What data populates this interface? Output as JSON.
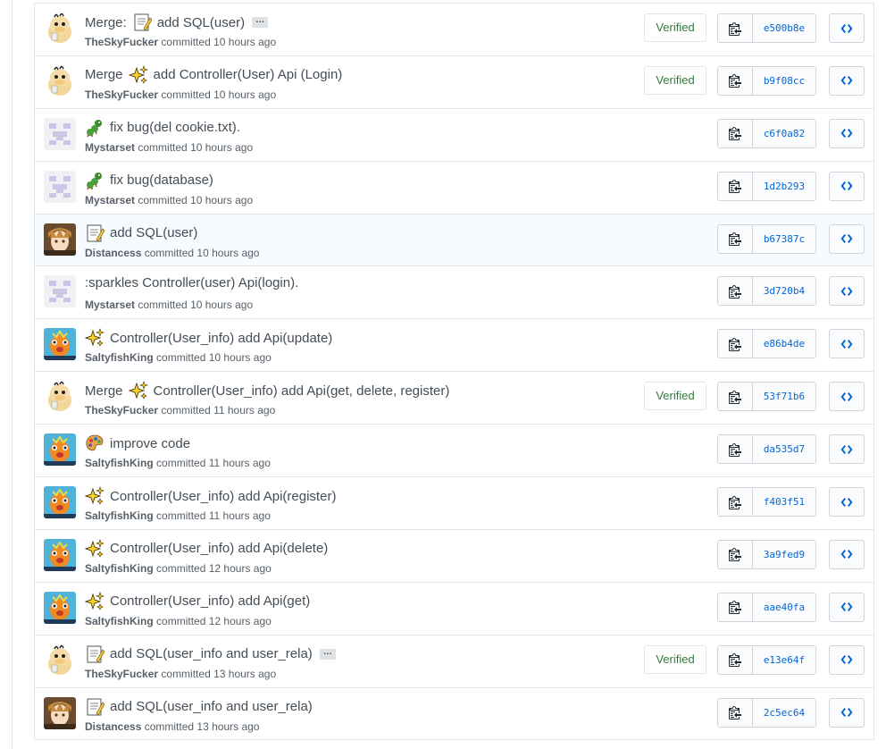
{
  "colors": {
    "link": "#0366d6",
    "verified": "#2f7a3c",
    "border": "#e1e4e8"
  },
  "commits": [
    {
      "merge": true,
      "merge_label": "Merge:",
      "emoji": "memo-emoji",
      "message": "add SQL(user)",
      "ellipsis": true,
      "ellipsis_label": "…",
      "author": "TheSkyFucker",
      "avatar": "duck-avatar",
      "committed": "committed",
      "time": "10 hours ago",
      "verified": true,
      "verified_label": "Verified",
      "sha": "e500b8e"
    },
    {
      "merge": true,
      "merge_label": "Merge",
      "emoji": "sparkles-emoji",
      "message": "add Controller(User) Api (Login)",
      "ellipsis": false,
      "author": "TheSkyFucker",
      "avatar": "duck-avatar",
      "committed": "committed",
      "time": "10 hours ago",
      "verified": true,
      "verified_label": "Verified",
      "sha": "b9f08cc"
    },
    {
      "merge": false,
      "emoji": "bug-emoji",
      "message": "fix bug(del cookie.txt).",
      "ellipsis": false,
      "author": "Mystarset",
      "avatar": "identicon-avatar",
      "committed": "committed",
      "time": "10 hours ago",
      "verified": false,
      "sha": "c6f0a82"
    },
    {
      "merge": false,
      "emoji": "bug-emoji",
      "message": "fix bug(database)",
      "ellipsis": false,
      "author": "Mystarset",
      "avatar": "identicon-avatar",
      "committed": "committed",
      "time": "10 hours ago",
      "verified": false,
      "sha": "1d2b293"
    },
    {
      "merge": false,
      "emoji": "memo-emoji",
      "message": "add SQL(user)",
      "ellipsis": false,
      "author": "Distancess",
      "avatar": "anime-avatar",
      "committed": "committed",
      "time": "10 hours ago",
      "verified": false,
      "sha": "b67387c",
      "highlight": true
    },
    {
      "merge": false,
      "emoji": "",
      "message": ":sparkles Controller(user) Api(login).",
      "ellipsis": false,
      "author": "Mystarset",
      "avatar": "identicon-avatar",
      "committed": "committed",
      "time": "10 hours ago",
      "verified": false,
      "sha": "3d720b4"
    },
    {
      "merge": false,
      "emoji": "sparkles-emoji",
      "message": "Controller(User_info) add Api(update)",
      "ellipsis": false,
      "author": "SaltyfishKing",
      "avatar": "fish-avatar",
      "committed": "committed",
      "time": "10 hours ago",
      "verified": false,
      "sha": "e86b4de"
    },
    {
      "merge": true,
      "merge_label": "Merge",
      "emoji": "sparkles-emoji",
      "message": "Controller(User_info) add Api(get, delete, register)",
      "ellipsis": false,
      "author": "TheSkyFucker",
      "avatar": "duck-avatar",
      "committed": "committed",
      "time": "11 hours ago",
      "verified": true,
      "verified_label": "Verified",
      "sha": "53f71b6"
    },
    {
      "merge": false,
      "emoji": "art-emoji",
      "message": "improve code",
      "ellipsis": false,
      "author": "SaltyfishKing",
      "avatar": "fish-avatar",
      "committed": "committed",
      "time": "11 hours ago",
      "verified": false,
      "sha": "da535d7"
    },
    {
      "merge": false,
      "emoji": "sparkles-emoji",
      "message": "Controller(User_info) add Api(register)",
      "ellipsis": false,
      "author": "SaltyfishKing",
      "avatar": "fish-avatar",
      "committed": "committed",
      "time": "11 hours ago",
      "verified": false,
      "sha": "f403f51"
    },
    {
      "merge": false,
      "emoji": "sparkles-emoji",
      "message": "Controller(User_info) add Api(delete)",
      "ellipsis": false,
      "author": "SaltyfishKing",
      "avatar": "fish-avatar",
      "committed": "committed",
      "time": "12 hours ago",
      "verified": false,
      "sha": "3a9fed9"
    },
    {
      "merge": false,
      "emoji": "sparkles-emoji",
      "message": "Controller(User_info) add Api(get)",
      "ellipsis": false,
      "author": "SaltyfishKing",
      "avatar": "fish-avatar",
      "committed": "committed",
      "time": "12 hours ago",
      "verified": false,
      "sha": "aae40fa"
    },
    {
      "merge": false,
      "emoji": "memo-emoji",
      "message": "add SQL(user_info and user_rela)",
      "ellipsis": true,
      "ellipsis_label": "…",
      "author": "TheSkyFucker",
      "avatar": "duck-avatar",
      "committed": "committed",
      "time": "13 hours ago",
      "verified": true,
      "verified_label": "Verified",
      "sha": "e13e64f"
    },
    {
      "merge": false,
      "emoji": "memo-emoji",
      "message": "add SQL(user_info and user_rela)",
      "ellipsis": false,
      "author": "Distancess",
      "avatar": "anime-avatar",
      "committed": "committed",
      "time": "13 hours ago",
      "verified": false,
      "sha": "2c5ec64"
    }
  ]
}
